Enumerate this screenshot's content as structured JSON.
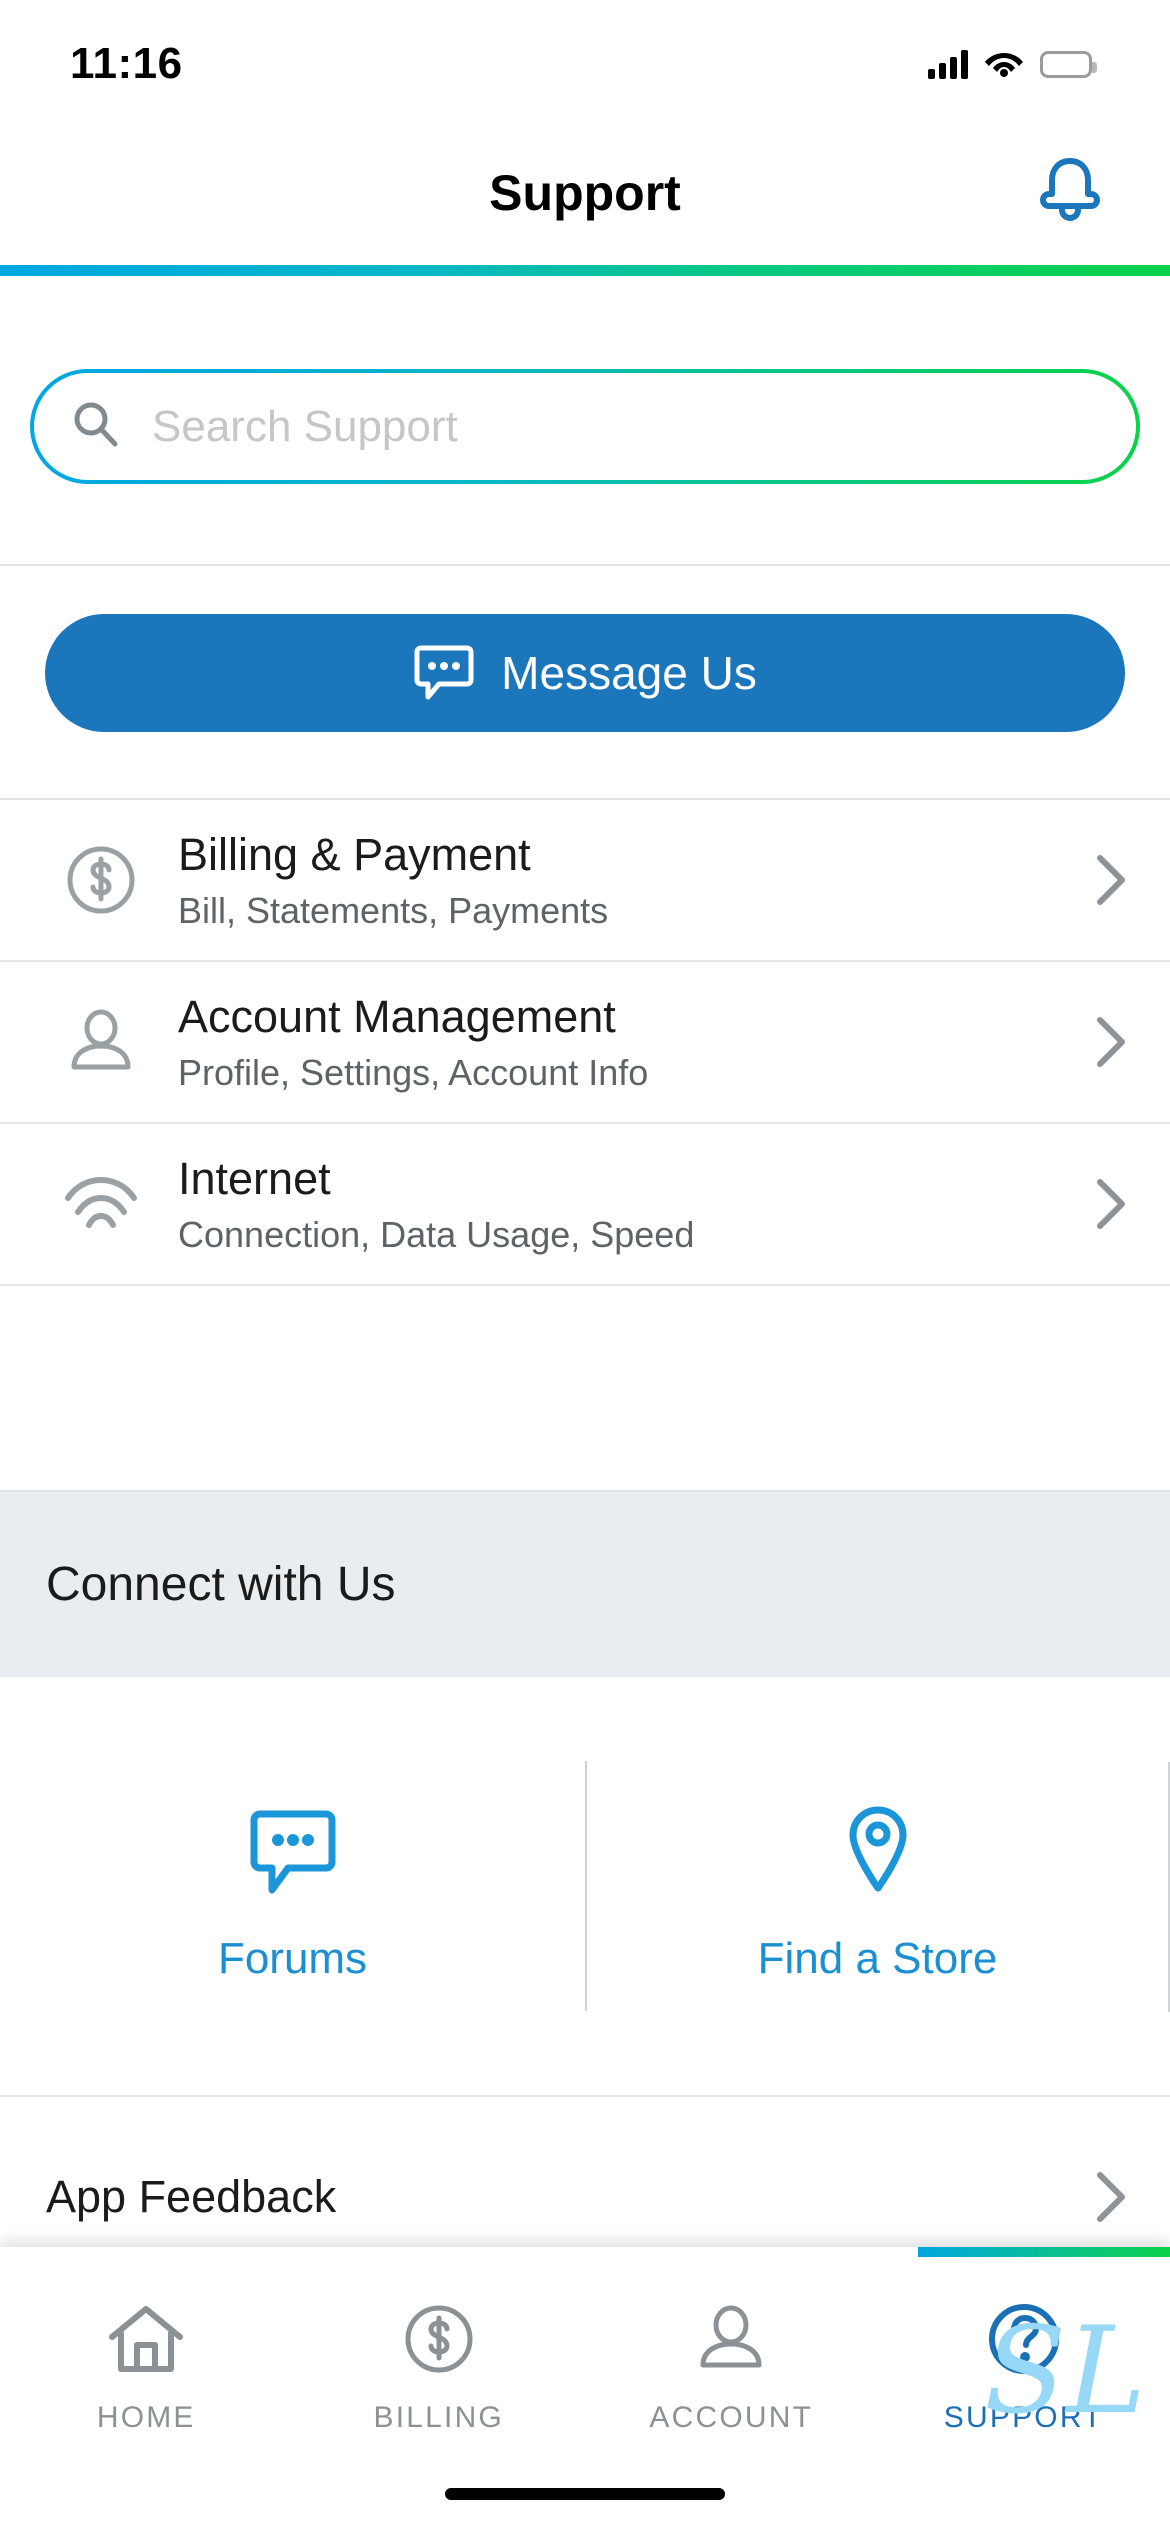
{
  "status_bar": {
    "time": "11:16",
    "cellular_icon": "signal-bars-icon",
    "wifi_icon": "wifi-icon",
    "battery_icon": "battery-icon",
    "battery_color": "#fcc200"
  },
  "header": {
    "title": "Support",
    "notifications_icon": "bell-icon",
    "accent_start": "#00a7e1",
    "accent_end": "#0bd24a"
  },
  "search": {
    "placeholder": "Search Support",
    "icon": "search-icon",
    "value": ""
  },
  "message_us": {
    "label": "Message Us",
    "icon": "chat-bubble-icon",
    "color": "#1b76bc"
  },
  "categories": [
    {
      "icon": "dollar-circle-icon",
      "title": "Billing & Payment",
      "subtitle": "Bill, Statements, Payments",
      "chevron": "chevron-right-icon"
    },
    {
      "icon": "person-icon",
      "title": "Account Management",
      "subtitle": "Profile, Settings, Account Info",
      "chevron": "chevron-right-icon"
    },
    {
      "icon": "wifi-icon",
      "title": "Internet",
      "subtitle": "Connection, Data Usage, Speed",
      "chevron": "chevron-right-icon"
    }
  ],
  "connect": {
    "heading": "Connect with Us",
    "tiles": [
      {
        "icon": "chat-bubble-icon",
        "label": "Forums"
      },
      {
        "icon": "map-pin-icon",
        "label": "Find a Store"
      }
    ],
    "link_color": "#1b8fd1"
  },
  "feedback": {
    "label": "App Feedback",
    "chevron": "chevron-right-icon"
  },
  "tab_bar": {
    "active_tab": "SUPPORT",
    "tabs": [
      {
        "icon": "home-icon",
        "label": "HOME",
        "active": false
      },
      {
        "icon": "dollar-circle-icon",
        "label": "BILLING",
        "active": false
      },
      {
        "icon": "person-icon",
        "label": "ACCOUNT",
        "active": false
      },
      {
        "icon": "question-circle-icon",
        "label": "SUPPORT",
        "active": true
      }
    ]
  },
  "watermark": {
    "text": "SL"
  }
}
